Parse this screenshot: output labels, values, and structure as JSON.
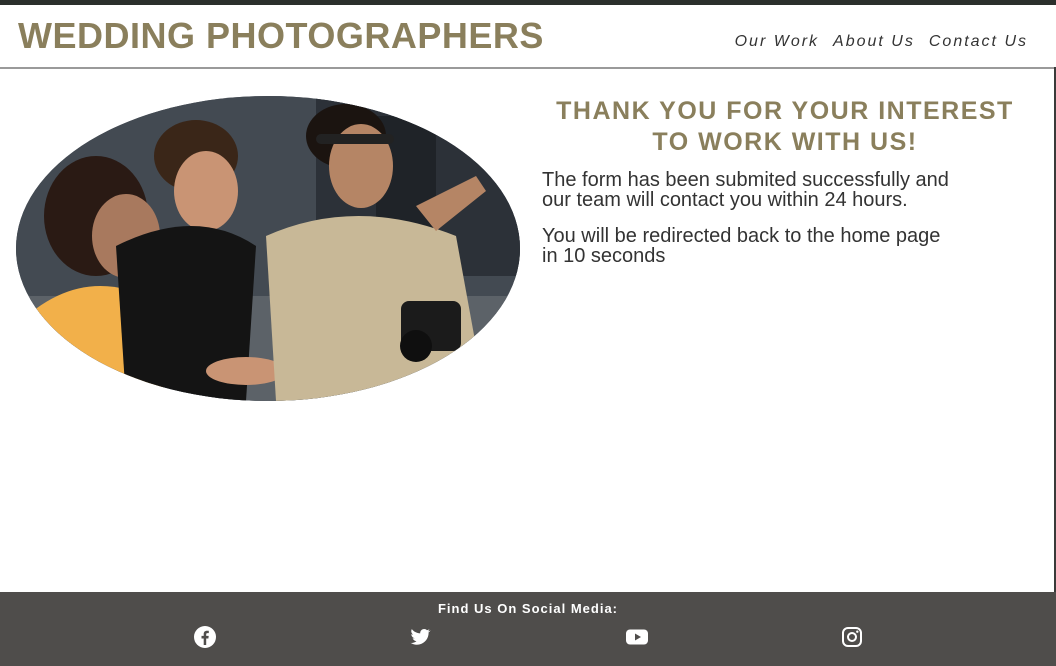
{
  "header": {
    "brand": "WEDDING PHOTOGRAPHERS",
    "nav": [
      {
        "label": "Our Work"
      },
      {
        "label": "About Us"
      },
      {
        "label": "Contact Us"
      }
    ]
  },
  "main": {
    "image_alt": "Photographers reviewing shots",
    "heading_line1": "THANK YOU FOR YOUR INTEREST",
    "heading_line2": "TO WORK WITH US!",
    "message_line1": "The form has been submited successfully and",
    "message_line2": "our team will contact you within 24 hours.",
    "redirect_line1": "You will be redirected back to the home page",
    "redirect_line2": "in 10 seconds"
  },
  "footer": {
    "title": "Find Us On Social Media:",
    "icons": [
      "facebook-icon",
      "twitter-icon",
      "youtube-icon",
      "instagram-icon"
    ]
  },
  "colors": {
    "accent": "#8a7f5c",
    "footer_bg": "#4f4d4b",
    "top_bar": "#2b2f2c"
  }
}
